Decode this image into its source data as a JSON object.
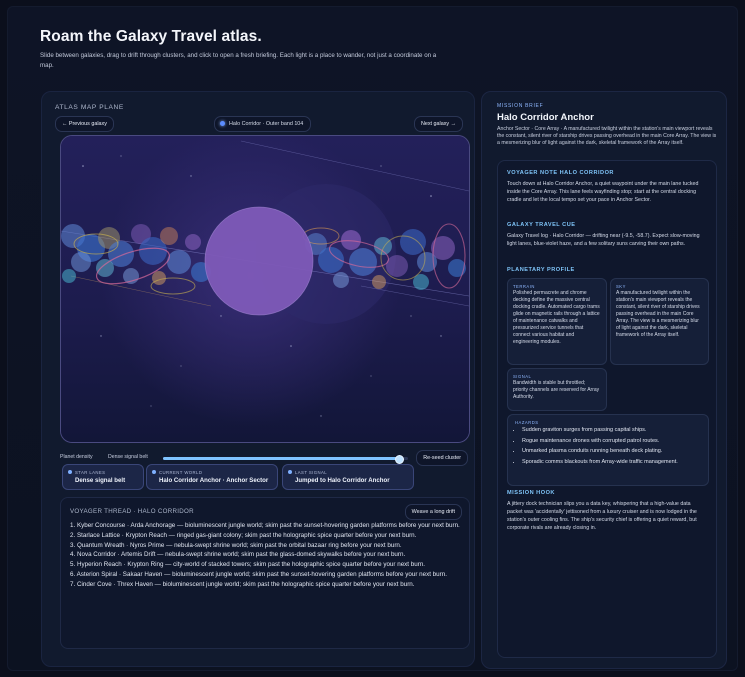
{
  "page": {
    "title": "Roam the Galaxy Travel atlas.",
    "subtitle": "Slide between galaxies, drag to drift through clusters, and click to open a fresh briefing. Each light is a place to wander, not just a coordinate on a map."
  },
  "atlas": {
    "label": "ATLAS MAP PLANE",
    "prev_label": "← Previous galaxy",
    "next_label": "Next galaxy →",
    "location": "Halo Corridor · Outer band 104",
    "density_label": "Planet density",
    "density_value": "Dense signal belt",
    "density_level": 0.96,
    "reseed_label": "Re-seed cluster",
    "chips": [
      {
        "label": "STAR LANES",
        "value": "Dense signal belt"
      },
      {
        "label": "CURRENT WORLD",
        "value": "Halo Corridor Anchor · Anchor Sector"
      },
      {
        "label": "LAST SIGNAL",
        "value": "Jumped to Halo Corridor Anchor"
      }
    ]
  },
  "thread": {
    "label": "VOYAGER THREAD · HALO CORRIDOR",
    "weave_label": "Weave a long drift",
    "items": [
      "1. Kyber Concourse · Arda Anchorage — bioluminescent jungle world; skim past the sunset-hovering garden platforms before your next burn.",
      "2. Starlace Lattice · Krypton Reach — ringed gas-giant colony; skim past the holographic spice quarter before your next burn.",
      "3. Quantum Wreath · Nyros Prime — nebula-swept shrine world; skim past the orbital bazaar ring before your next burn.",
      "4. Nova Corridor · Artemis Drift — nebula-swept shrine world; skim past the glass-domed skywalks before your next burn.",
      "5. Hyperion Reach · Krypton Ring — city-world of stacked towers; skim past the holographic spice quarter before your next burn.",
      "6. Asterion Spiral · Sakaar Haven — bioluminescent jungle world; skim past the sunset-hovering garden platforms before your next burn.",
      "7. Cinder Cove · Threx Haven — bioluminescent jungle world; skim past the holographic spice quarter before your next burn."
    ]
  },
  "brief": {
    "kicker": "MISSION BRIEF",
    "title": "Halo Corridor Anchor",
    "lead": "Anchor Sector · Core Array · A manufactured twilight within the station's main viewport reveals the constant, silent river of starship drives passing overhead in the main Core Array. The view is a mesmerizing blur of light against the dark, skeletal framework of the Array itself.",
    "voyager_title": "VOYAGER NOTE HALO CORRIDOR",
    "voyager_text": "Touch down at Halo Corridor Anchor, a quiet waypoint under the main lane tucked inside the Core Array. This lane feels wayfinding stop; start at the central docking cradle and let the local tempo set your pace in Anchor Sector.",
    "cue_title": "GALAXY TRAVEL CUE",
    "cue_text": "Galaxy Travel log · Halo Corridor — drifting near (-9.5, -58.7). Expect slow-moving light lanes, blue-violet haze, and a few solitary suns carving their own paths.",
    "profile_title": "PLANETARY PROFILE",
    "terrain_label": "TERRAIN",
    "terrain_text": "Polished permacrete and chrome decking define the massive central docking cradle. Automated cargo trams glide on magnetic rails through a lattice of maintenance catwalks and pressurized service tunnels that connect various habitat and engineering modules.",
    "sky_label": "SKY",
    "sky_text": "A manufactured twilight within the station's main viewport reveals the constant, silent river of starship drives passing overhead in the main Core Array. The view is a mesmerizing blur of light against the dark, skeletal framework of the Array itself.",
    "signal_label": "SIGNAL",
    "signal_text": "Bandwidth is stable but throttled; priority channels are reserved for Array Authority.",
    "hazards_label": "HAZARDS",
    "hazards": [
      "Sudden graviton surges from passing capital ships.",
      "Rogue maintenance drones with corrupted patrol routes.",
      "Unmarked plasma conduits running beneath deck plating.",
      "Sporadic comms blackouts from Array-wide traffic management."
    ],
    "hook_title": "MISSION HOOK",
    "hook_text": "A jittery dock technician slips you a data key, whispering that a high-value data packet was 'accidentally' jettisoned from a luxury cruiser and is now lodged in the station's outer cooling fins. The ship's security chief is offering a quiet reward, but corporate rivals are already closing in."
  },
  "colors": {
    "accent": "#7fc4ff",
    "map_bg": "#1b1b4a",
    "core_planet": "#7e5ab8"
  }
}
